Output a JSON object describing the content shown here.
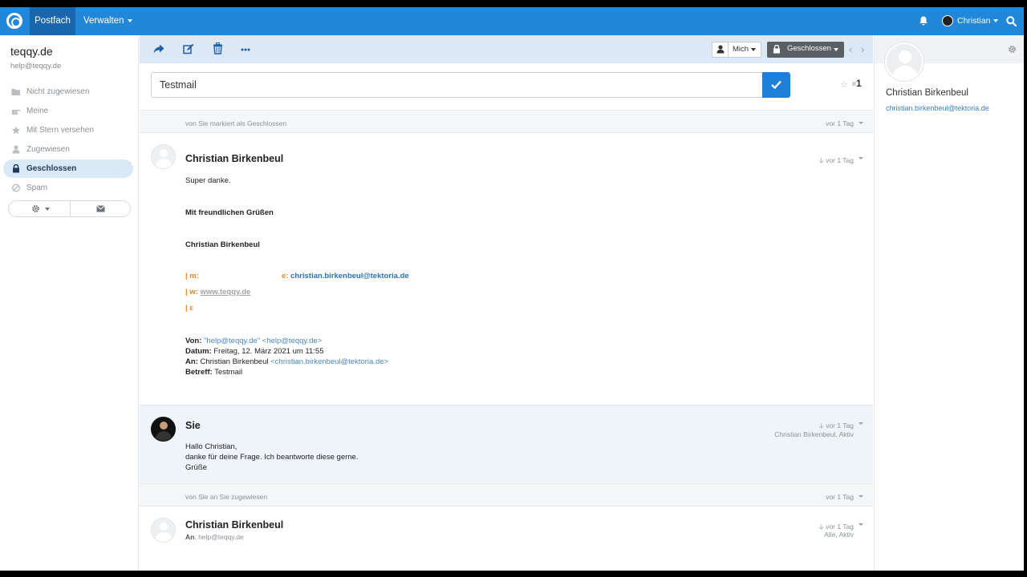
{
  "topnav": {
    "tabs": [
      {
        "label": "Postfach"
      },
      {
        "label": "Verwalten"
      }
    ],
    "user_name": "Christian"
  },
  "sidebar": {
    "mailbox_name": "teqqy.de",
    "mailbox_email": "help@teqqy.de",
    "items": [
      {
        "label": "Nicht zugewiesen",
        "icon": "folder-icon"
      },
      {
        "label": "Meine",
        "icon": "hand-pointer-icon"
      },
      {
        "label": "Mit Stern versehen",
        "icon": "star-icon"
      },
      {
        "label": "Zugewiesen",
        "icon": "user-icon"
      },
      {
        "label": "Geschlossen",
        "icon": "lock-icon"
      },
      {
        "label": "Spam",
        "icon": "ban-icon"
      }
    ]
  },
  "toolbar": {
    "assignee": "Mich",
    "status": "Geschlossen"
  },
  "subject": {
    "value": "Testmail",
    "ticket_hash": "#",
    "ticket_number": "1"
  },
  "timeline": {
    "line1": {
      "text": "von Sie markiert als Geschlossen",
      "time": "vor 1 Tag"
    },
    "thread1": {
      "name": "Christian Birkenbeul",
      "time": "vor 1 Tag",
      "body_line1": "Super danke.",
      "greeting": "Mit freundlichen Grüßen",
      "signature_name": "Christian Birkenbeul",
      "sig_m_label": "| m:",
      "sig_e_label": "e:",
      "sig_email": "christian.birkenbeul@tektoria.de",
      "sig_w_label": "| w:",
      "sig_web": "www.teqqy.de",
      "sig_last": "| ɛ",
      "von_label": "Von:",
      "von_value": "\"help@teqqy.de\" <help@teqqy.de>",
      "datum_label": "Datum:",
      "datum_value": "Freitag, 12. März 2021 um 11:55",
      "an_label": "An:",
      "an_name": "Christian Birkenbeul",
      "an_email": "<christian.birkenbeul@tektoria.de>",
      "betreff_label": "Betreff:",
      "betreff_value": "Testmail"
    },
    "thread2": {
      "name": "Sie",
      "time": "vor 1 Tag",
      "meta": "Christian Birkenbeul, Aktiv",
      "line1": "Hallo Christian,",
      "line2": "danke für deine Frage. Ich beantworte diese gerne.",
      "line3": "Grüße"
    },
    "line2": {
      "text": "von Sie an Sie zugewiesen",
      "time": "vor 1 Tag"
    },
    "thread3": {
      "name": "Christian Birkenbeul",
      "time": "vor 1 Tag",
      "meta": "Alle, Aktiv",
      "an_label": "An",
      "an_value": "help@teqqy.de"
    }
  },
  "customer": {
    "name": "Christian Birkenbeul",
    "email": "christian.birkenbeul@tektoria.de"
  },
  "colors": {
    "topnav": "#2286d9",
    "active_tab": "#1866ae",
    "accent": "#1d7fd9",
    "toolbar": "#dce8f5",
    "status_closed": "#5b5f63"
  }
}
